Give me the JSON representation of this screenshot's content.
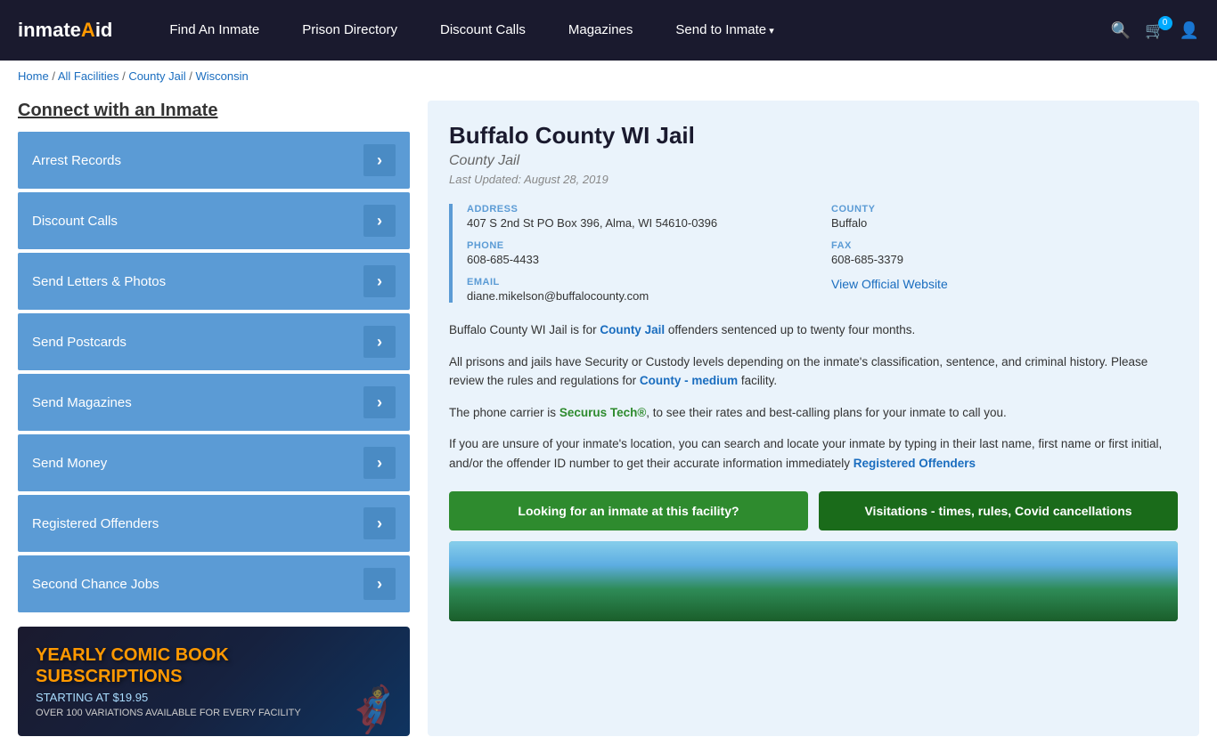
{
  "nav": {
    "logo": "inmateAid",
    "links": [
      {
        "id": "find-inmate",
        "label": "Find An Inmate",
        "dropdown": false
      },
      {
        "id": "prison-directory",
        "label": "Prison Directory",
        "dropdown": false
      },
      {
        "id": "discount-calls",
        "label": "Discount Calls",
        "dropdown": false
      },
      {
        "id": "magazines",
        "label": "Magazines",
        "dropdown": false
      },
      {
        "id": "send-to-inmate",
        "label": "Send to Inmate",
        "dropdown": true
      }
    ],
    "cart_count": "0"
  },
  "breadcrumb": {
    "items": [
      "Home",
      "All Facilities",
      "County Jail",
      "Wisconsin"
    ]
  },
  "sidebar": {
    "title": "Connect with an Inmate",
    "menu_items": [
      "Arrest Records",
      "Discount Calls",
      "Send Letters & Photos",
      "Send Postcards",
      "Send Magazines",
      "Send Money",
      "Registered Offenders",
      "Second Chance Jobs"
    ]
  },
  "ad": {
    "title": "YEARLY COMIC BOOK\nSUBSCRIPTIONS",
    "subtitle": "STARTING AT $19.95",
    "desc": "OVER 100 VARIATIONS AVAILABLE FOR EVERY FACILITY"
  },
  "facility": {
    "title": "Buffalo County WI Jail",
    "type": "County Jail",
    "last_updated": "Last Updated: August 28, 2019",
    "address_label": "ADDRESS",
    "address_value": "407 S 2nd St PO Box 396, Alma, WI 54610-0396",
    "county_label": "COUNTY",
    "county_value": "Buffalo",
    "phone_label": "PHONE",
    "phone_value": "608-685-4433",
    "fax_label": "FAX",
    "fax_value": "608-685-3379",
    "email_label": "EMAIL",
    "email_value": "diane.mikelson@buffalocounty.com",
    "website_label": "View Official Website",
    "website_url": "#",
    "desc1": "Buffalo County WI Jail is for County Jail offenders sentenced up to twenty four months.",
    "desc2": "All prisons and jails have Security or Custody levels depending on the inmate's classification, sentence, and criminal history. Please review the rules and regulations for County - medium facility.",
    "desc3": "The phone carrier is Securus Tech®, to see their rates and best-calling plans for your inmate to call you.",
    "desc4": "If you are unsure of your inmate's location, you can search and locate your inmate by typing in their last name, first name or first initial, and/or the offender ID number to get their accurate information immediately Registered Offenders",
    "cta1": "Looking for an inmate at this facility?",
    "cta2": "Visitations - times, rules, Covid cancellations"
  }
}
